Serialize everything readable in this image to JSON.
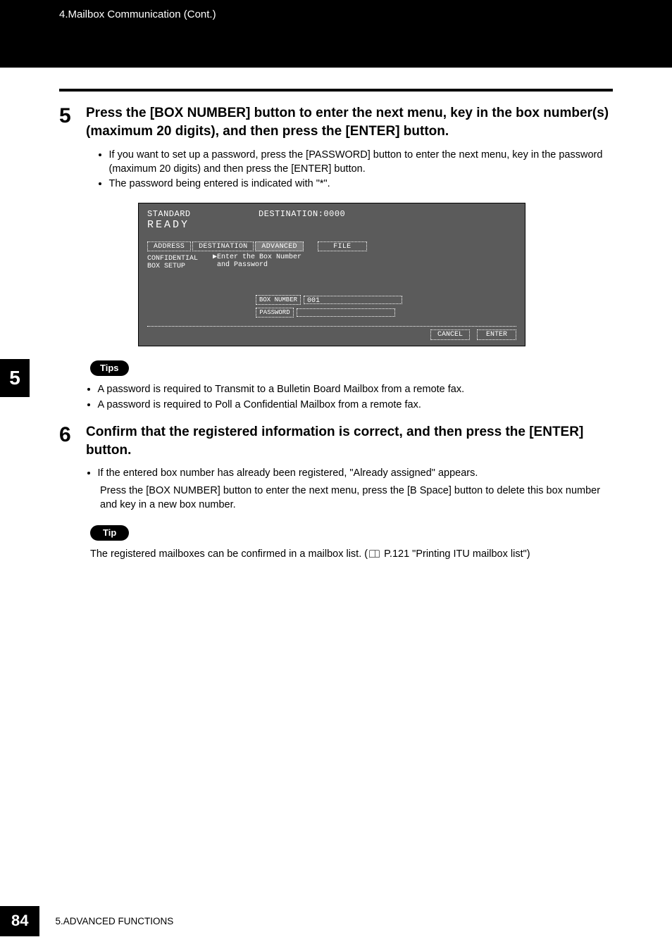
{
  "header": {
    "breadcrumb": "4.Mailbox Communication (Cont.)"
  },
  "chapter_tab": "5",
  "step5": {
    "num": "5",
    "heading": "Press the [BOX NUMBER] button to enter the next menu, key in the box number(s) (maximum 20 digits), and then press the [ENTER] button.",
    "bullet1": "If you want to set up a password, press the [PASSWORD] button to enter the next menu, key in the password (maximum 20 digits) and then press the [ENTER] button.",
    "bullet2": "The password being entered is indicated with \"*\"."
  },
  "lcd": {
    "standard": "STANDARD",
    "destination_hdr": "DESTINATION:0000",
    "ready": "READY",
    "tab_address": "ADDRESS",
    "tab_destination": "DESTINATION",
    "tab_advanced": "ADVANCED",
    "tab_file": "FILE",
    "leftlabel": "CONFIDENTIAL\nBOX SETUP",
    "hint": "▶Enter the Box Number\n and Password",
    "boxnum_btn": "BOX NUMBER",
    "boxnum_val": "001",
    "password_btn": "PASSWORD",
    "cancel": "CANCEL",
    "enter": "ENTER"
  },
  "tips_pill": "Tips",
  "tips": {
    "t1": "A password is required to Transmit to a Bulletin Board Mailbox from a remote fax.",
    "t2": "A password is required to Poll a Confidential Mailbox from a remote fax."
  },
  "step6": {
    "num": "6",
    "heading": "Confirm that the registered information is correct, and then press the [ENTER] button.",
    "bullet1": "If the entered box number has already been registered, \"Already assigned\" appears.",
    "cont": "Press the [BOX NUMBER] button to enter the next menu, press the [B Space] button to delete this box number and key in a new box number."
  },
  "tip_pill": "Tip",
  "tip_text_a": "The registered mailboxes can be confirmed in a mailbox list. (",
  "tip_text_b": " P.121 \"Printing ITU mailbox list\")",
  "footer": {
    "page": "84",
    "section": "5.ADVANCED FUNCTIONS"
  }
}
